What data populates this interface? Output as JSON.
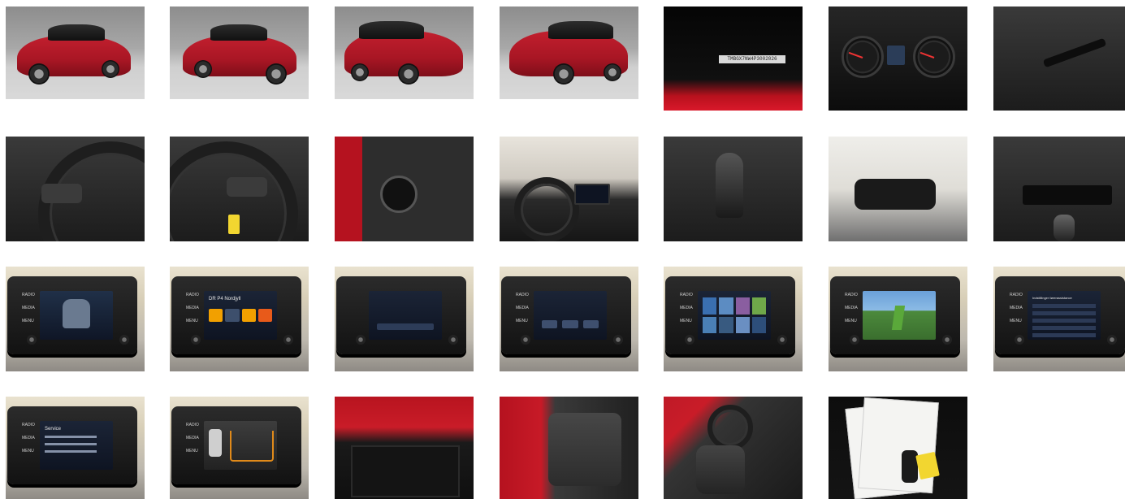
{
  "gallery": {
    "photos": [
      {
        "id": "exterior-front-left",
        "subject": "exterior-front-left"
      },
      {
        "id": "exterior-front-right",
        "subject": "exterior-front-right"
      },
      {
        "id": "exterior-rear-left",
        "subject": "exterior-rear-left"
      },
      {
        "id": "exterior-rear-right",
        "subject": "exterior-rear-right"
      },
      {
        "id": "vin-plate",
        "subject": "vin-plate"
      },
      {
        "id": "instrument-cluster",
        "subject": "instrument-cluster"
      },
      {
        "id": "stalk-controls",
        "subject": "stalk-controls"
      },
      {
        "id": "steering-wheel-left",
        "subject": "steering-wheel-left"
      },
      {
        "id": "steering-wheel-right",
        "subject": "steering-wheel-right"
      },
      {
        "id": "light-switch",
        "subject": "light-switch"
      },
      {
        "id": "dashboard",
        "subject": "dashboard"
      },
      {
        "id": "gear-shifter",
        "subject": "gear-shifter"
      },
      {
        "id": "rearview-mirror",
        "subject": "rearview-mirror"
      },
      {
        "id": "climate-controls",
        "subject": "climate-controls"
      },
      {
        "id": "infotainment-vehicle",
        "subject": "infotainment-vehicle"
      },
      {
        "id": "infotainment-radio",
        "subject": "infotainment-radio"
      },
      {
        "id": "infotainment-phone",
        "subject": "infotainment-phone"
      },
      {
        "id": "infotainment-connect",
        "subject": "infotainment-connect"
      },
      {
        "id": "infotainment-apps",
        "subject": "infotainment-apps"
      },
      {
        "id": "infotainment-lane-assist",
        "subject": "infotainment-lane-assist"
      },
      {
        "id": "infotainment-settings",
        "subject": "infotainment-settings"
      },
      {
        "id": "infotainment-service",
        "subject": "infotainment-service"
      },
      {
        "id": "infotainment-parking-camera",
        "subject": "infotainment-parking-camera"
      },
      {
        "id": "trunk",
        "subject": "trunk"
      },
      {
        "id": "rear-seats",
        "subject": "rear-seats"
      },
      {
        "id": "front-seats",
        "subject": "front-seats"
      },
      {
        "id": "documents-and-keys",
        "subject": "documents-and-keys"
      }
    ]
  },
  "texts": {
    "vin_plate": "TMBGX7NW4P3002026",
    "radio_label": "RADIO",
    "media_label": "MEDIA",
    "menu_label": "MENU",
    "radio_station": "DR P4 Nordjyll",
    "settings_title": "Indstillinger førerassistance",
    "service_title": "Service"
  },
  "colors": {
    "car_red": "#c21f2e",
    "studio_gray": "#a8a8a8",
    "screen_dark": "#0e1422",
    "page_bg": "#ffffff"
  }
}
